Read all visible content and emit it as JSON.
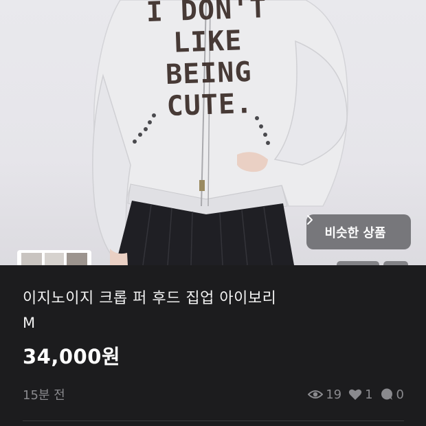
{
  "product": {
    "title": "이지노이지 크롭 퍼 후드 집업 아이보리",
    "size": "M",
    "price": "34,000원",
    "posted": "15분 전",
    "stats": {
      "views": "19",
      "likes": "1",
      "chats": "0"
    }
  },
  "photo": {
    "print_lines": [
      "I DON'T",
      "LIKE",
      "BEING",
      "CUTE."
    ]
  },
  "actions": {
    "similar_label": "비슷한 상품"
  },
  "colors": {
    "background": "#1c1c1e",
    "text_primary": "#f2f2f2",
    "text_muted": "#8a8a8e",
    "button_bg": "#6e6e72"
  },
  "icons": {
    "chevron": "chevron-right-icon",
    "views": "eye-icon",
    "likes": "heart-icon",
    "chats": "chat-bubble-icon"
  }
}
